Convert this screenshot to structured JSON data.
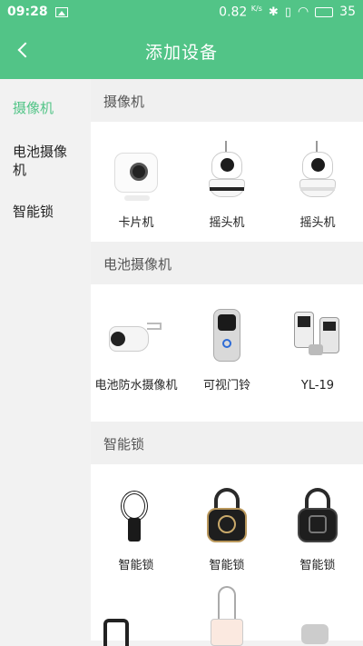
{
  "status_bar": {
    "time": "09:28",
    "speed": "0.82",
    "speed_unit": "K/s",
    "battery": "35"
  },
  "header": {
    "title": "添加设备"
  },
  "sidebar": {
    "items": [
      {
        "label": "摄像机",
        "active": true
      },
      {
        "label": "电池摄像机",
        "active": false
      },
      {
        "label": "智能锁",
        "active": false
      }
    ]
  },
  "sections": [
    {
      "title": "摄像机",
      "items": [
        {
          "label": "卡片机",
          "icon": "cube-camera-icon"
        },
        {
          "label": "摇头机",
          "icon": "ptz-camera-icon"
        },
        {
          "label": "摇头机",
          "icon": "ptz-camera-icon"
        }
      ]
    },
    {
      "title": "电池摄像机",
      "items": [
        {
          "label": "电池防水摄像机",
          "icon": "bullet-camera-icon"
        },
        {
          "label": "可视门铃",
          "icon": "doorbell-icon"
        },
        {
          "label": "YL-19",
          "icon": "smart-lock-icon"
        }
      ]
    },
    {
      "title": "智能锁",
      "items": [
        {
          "label": "智能锁",
          "icon": "cable-lock-icon"
        },
        {
          "label": "智能锁",
          "icon": "padlock-icon"
        },
        {
          "label": "智能锁",
          "icon": "padlock-icon"
        }
      ]
    }
  ],
  "colors": {
    "accent": "#52c487"
  }
}
